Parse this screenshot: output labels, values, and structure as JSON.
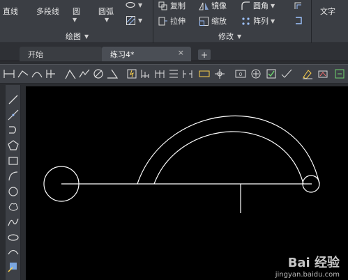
{
  "ribbon": {
    "draw_panel": {
      "title": "绘图",
      "tools": {
        "line": "直线",
        "polyline": "多段线",
        "circle": "圆",
        "arc": "圆弧"
      }
    },
    "modify_panel": {
      "title": "修改",
      "tools": {
        "copy": "复制",
        "mirror": "镜像",
        "fillet": "圆角",
        "stretch": "拉伸",
        "scale": "缩放",
        "array": "阵列"
      }
    },
    "text_panel": {
      "text": "文字"
    }
  },
  "tabs": [
    {
      "label": "开始",
      "active": false
    },
    {
      "label": "练习4*",
      "active": true,
      "close": "×"
    }
  ],
  "new_tab": "+",
  "watermark": {
    "brand": "Bai 经验",
    "url": "jingyan.baidu.com"
  },
  "colors": {
    "canvas": "#000000",
    "geometry": "#ffffff",
    "ribbon": "#3b3e44"
  }
}
